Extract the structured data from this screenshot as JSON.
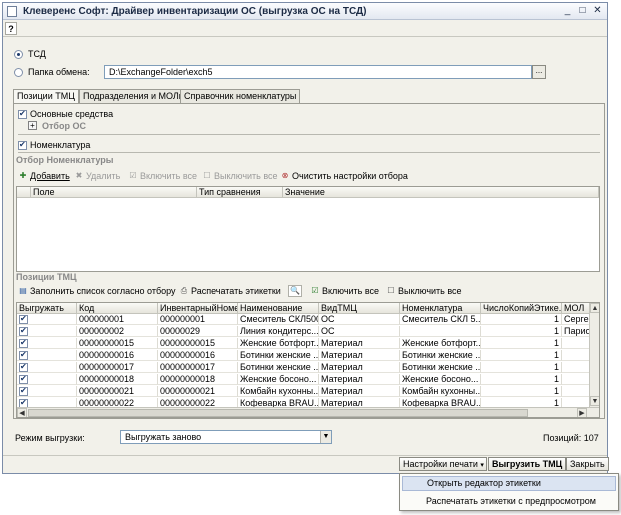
{
  "window": {
    "title": "Клеверенс Софт: Драйвер инвентаризации ОС (выгрузка ОС на ТСД)",
    "help_label": "?"
  },
  "target": {
    "tsd_label": "ТСД",
    "folder_label": "Папка обмена:",
    "folder_value": "D:\\ExchangeFolder\\exch5",
    "ellipsis": "..."
  },
  "tabs": [
    {
      "label": "Позиции ТМЦ"
    },
    {
      "label": "Подразделения и МОЛы"
    },
    {
      "label": "Справочник номенклатуры"
    }
  ],
  "filters": {
    "fixed_assets_label": "Основные средства",
    "os_filter_title": "Отбор ОС",
    "nomenclature_label": "Номенклатура",
    "nomenclature_filter_title": "Отбор Номенклатуры"
  },
  "filter_toolbar": {
    "add": "Добавить",
    "remove": "Удалить",
    "enable_all": "Включить все",
    "disable_all": "Выключить все",
    "clear": "Очистить настройки отбора"
  },
  "filter_table": {
    "columns": [
      "Поле",
      "Тип сравнения",
      "Значение"
    ]
  },
  "positions": {
    "title": "Позиции ТМЦ",
    "fill_label": "Заполнить список согласно отбору",
    "print_label": "Распечатать этикетки",
    "enable_all": "Включить все",
    "disable_all": "Выключить все",
    "columns": [
      "Выгружать",
      "Код",
      "ИнвентарныйНомер",
      "Наименование",
      "ВидТМЦ",
      "Номенклатура",
      "ЧислоКопийЭтике...",
      "МОЛ"
    ],
    "rows": [
      {
        "code": "000000001",
        "inv": "000000001",
        "name": "Смеситель СКЛ500",
        "kind": "ОС",
        "nom": "Смеситель СКЛ 5...",
        "copies": "1",
        "mol": "Сергее"
      },
      {
        "code": "000000002",
        "inv": "00000029",
        "name": "Линия кондитерс...",
        "kind": "ОС",
        "nom": "",
        "copies": "1",
        "mol": "Парион"
      },
      {
        "code": "00000000015",
        "inv": "00000000015",
        "name": "Женские ботфорт...",
        "kind": "Материал",
        "nom": "Женские ботфорт...",
        "copies": "1",
        "mol": ""
      },
      {
        "code": "00000000016",
        "inv": "00000000016",
        "name": "Ботинки женские ...",
        "kind": "Материал",
        "nom": "Ботинки женские ...",
        "copies": "1",
        "mol": ""
      },
      {
        "code": "00000000017",
        "inv": "00000000017",
        "name": "Ботинки женские ...",
        "kind": "Материал",
        "nom": "Ботинки женские ...",
        "copies": "1",
        "mol": ""
      },
      {
        "code": "00000000018",
        "inv": "00000000018",
        "name": "Женские босоно...",
        "kind": "Материал",
        "nom": "Женские босоно...",
        "copies": "1",
        "mol": ""
      },
      {
        "code": "00000000021",
        "inv": "00000000021",
        "name": "Комбайн кухонны...",
        "kind": "Материал",
        "nom": "Комбайн кухонны...",
        "copies": "1",
        "mol": ""
      },
      {
        "code": "00000000022",
        "inv": "00000000022",
        "name": "Кофеварка BRAU...",
        "kind": "Материал",
        "nom": "Кофеварка BRAU...",
        "copies": "1",
        "mol": ""
      }
    ]
  },
  "mode": {
    "label": "Режим выгрузки:",
    "value": "Выгружать заново",
    "count_label": "Позиций: 107"
  },
  "buttons": {
    "print_settings": "Настройки печати",
    "upload": "Выгрузить ТМЦ",
    "close": "Закрыть"
  },
  "menu": {
    "items": [
      {
        "label": "Открыть редактор этикетки"
      },
      {
        "label": "Распечатать этикетки с предпросмотром"
      }
    ]
  }
}
